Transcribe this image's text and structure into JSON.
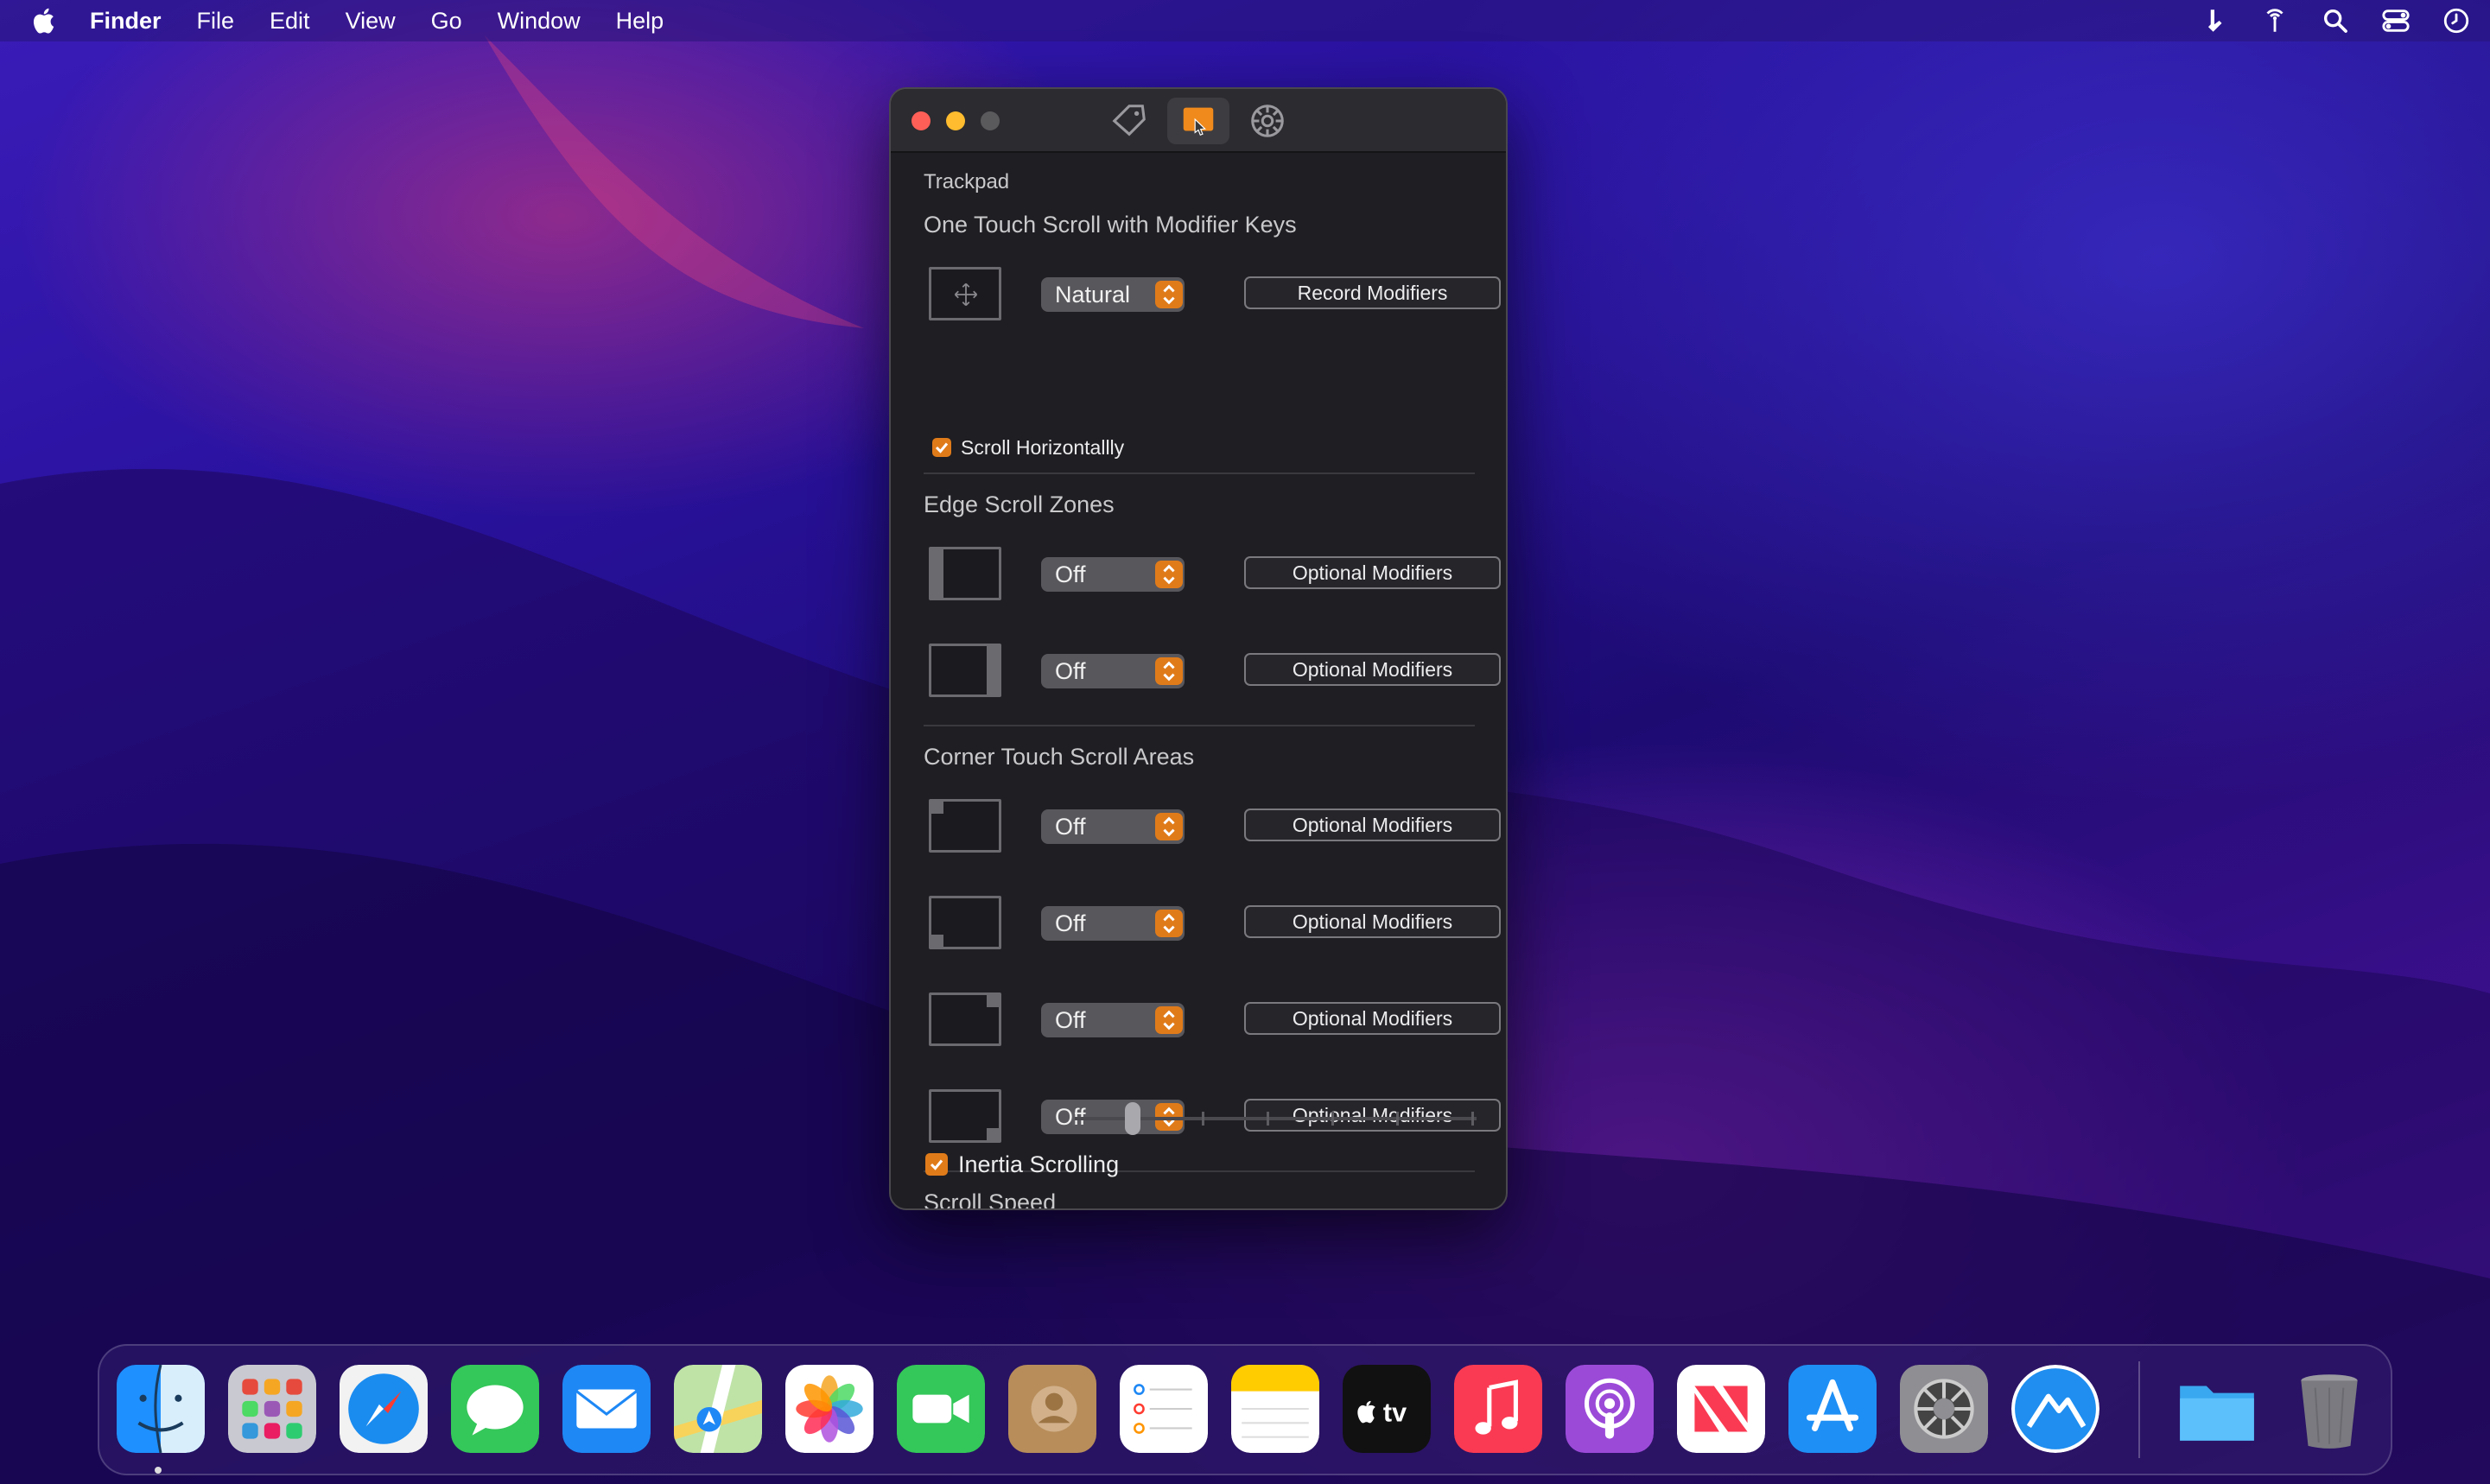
{
  "menubar": {
    "app_name": "Finder",
    "items": [
      "File",
      "Edit",
      "View",
      "Go",
      "Window",
      "Help"
    ]
  },
  "window": {
    "toolbar": {
      "tabs": [
        {
          "icon": "tag-icon",
          "active": false
        },
        {
          "icon": "trackpad-icon",
          "active": true
        },
        {
          "icon": "gear-icon",
          "active": false
        }
      ]
    },
    "group_label": "Trackpad",
    "one_touch": {
      "title": "One Touch Scroll with Modifier Keys",
      "direction": "Natural",
      "button": "Record Modifiers",
      "scroll_horizontally_label": "Scroll Horizontallly",
      "scroll_horizontally_checked": true
    },
    "edge_zones": {
      "title": "Edge Scroll Zones",
      "rows": [
        {
          "zone": "left-edge",
          "value": "Off",
          "button": "Optional Modifiers"
        },
        {
          "zone": "right-edge",
          "value": "Off",
          "button": "Optional Modifiers"
        }
      ]
    },
    "corner_areas": {
      "title": "Corner Touch Scroll Areas",
      "rows": [
        {
          "zone": "top-left",
          "value": "Off",
          "button": "Optional Modifiers"
        },
        {
          "zone": "bottom-left",
          "value": "Off",
          "button": "Optional Modifiers"
        },
        {
          "zone": "top-right",
          "value": "Off",
          "button": "Optional Modifiers"
        },
        {
          "zone": "bottom-right",
          "value": "Off",
          "button": "Optional Modifiers"
        }
      ]
    },
    "scroll_speed": {
      "label": "Scroll Speed",
      "value_fraction": 0.15
    },
    "inertia": {
      "label": "Inertia Scrolling",
      "checked": true
    }
  },
  "colors": {
    "accent": "#e07b1a",
    "window_bg": "#1f1e22"
  },
  "dock": {
    "apps": [
      "Finder",
      "Launchpad",
      "Safari",
      "Messages",
      "Mail",
      "Maps",
      "Photos",
      "FaceTime",
      "Contacts",
      "Reminders",
      "Notes",
      "TV",
      "Music",
      "Podcasts",
      "News",
      "App Store",
      "System Preferences",
      "Unknown App",
      "Folder",
      "Trash"
    ],
    "running": [
      "Finder"
    ]
  }
}
